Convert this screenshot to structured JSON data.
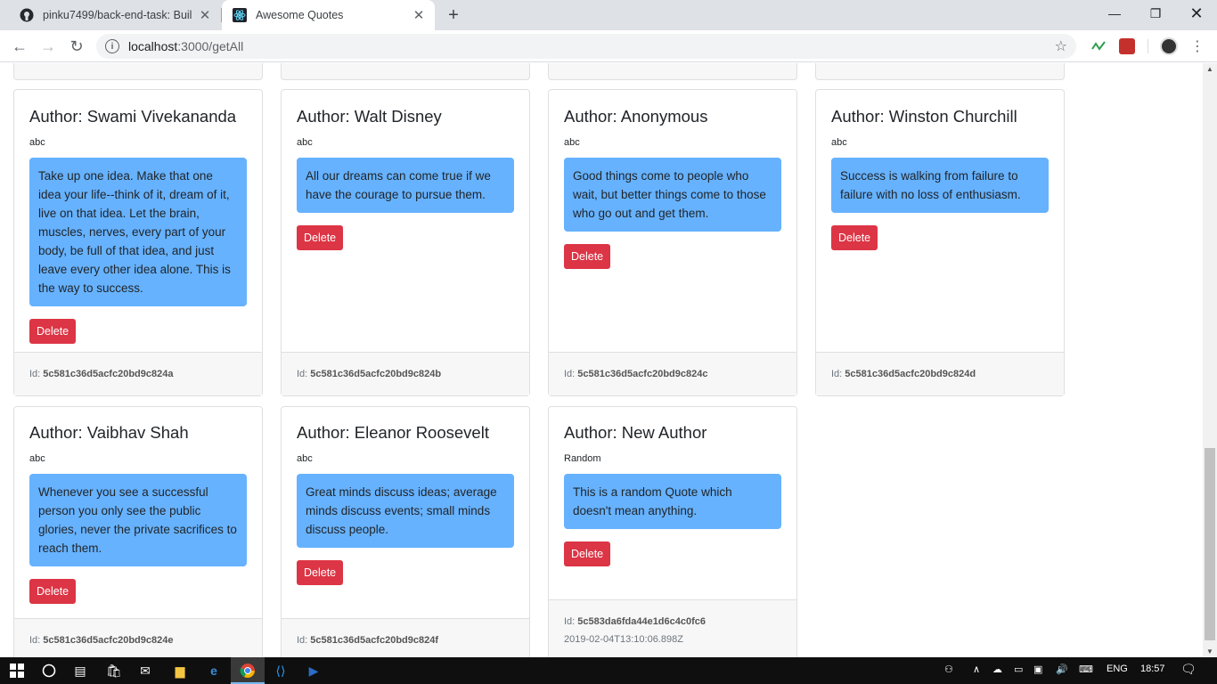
{
  "browser": {
    "tabs": [
      {
        "title": "pinku7499/back-end-task: Build",
        "icon": "github-icon"
      },
      {
        "title": "Awesome Quotes",
        "icon": "react-icon"
      }
    ],
    "url_host": "localhost",
    "url_path": ":3000/getAll"
  },
  "page": {
    "delete_label": "Delete",
    "id_prefix": "Id:",
    "cards": [
      {
        "author": "Author: Swami Vivekananda",
        "category": "abc",
        "quote": "Take up one idea. Make that one idea your life--think of it, dream of it, live on that idea. Let the brain, muscles, nerves, every part of your body, be full of that idea, and just leave every other idea alone. This is the way to success.",
        "id": "5c581c36d5acfc20bd9c824a"
      },
      {
        "author": "Author: Walt Disney",
        "category": "abc",
        "quote": "All our dreams can come true if we have the courage to pursue them.",
        "id": "5c581c36d5acfc20bd9c824b"
      },
      {
        "author": "Author: Anonymous",
        "category": "abc",
        "quote": "Good things come to people who wait, but better things come to those who go out and get them.",
        "id": "5c581c36d5acfc20bd9c824c"
      },
      {
        "author": "Author: Winston Churchill",
        "category": "abc",
        "quote": "Success is walking from failure to failure with no loss of enthusiasm.",
        "id": "5c581c36d5acfc20bd9c824d"
      },
      {
        "author": "Author: Vaibhav Shah",
        "category": "abc",
        "quote": "Whenever you see a successful person you only see the public glories, never the private sacrifices to reach them.",
        "id": "5c581c36d5acfc20bd9c824e"
      },
      {
        "author": "Author: Eleanor Roosevelt",
        "category": "abc",
        "quote": "Great minds discuss ideas; average minds discuss events; small minds discuss people.",
        "id": "5c581c36d5acfc20bd9c824f"
      },
      {
        "author": "Author: New Author",
        "category": "Random",
        "quote": "This is a random Quote which doesn't mean anything.",
        "id": "5c583da6fda44e1d6c4c0fc6",
        "date": "2019-02-04T13:10:06.898Z"
      }
    ]
  },
  "taskbar": {
    "language": "ENG",
    "time": "18:57"
  }
}
